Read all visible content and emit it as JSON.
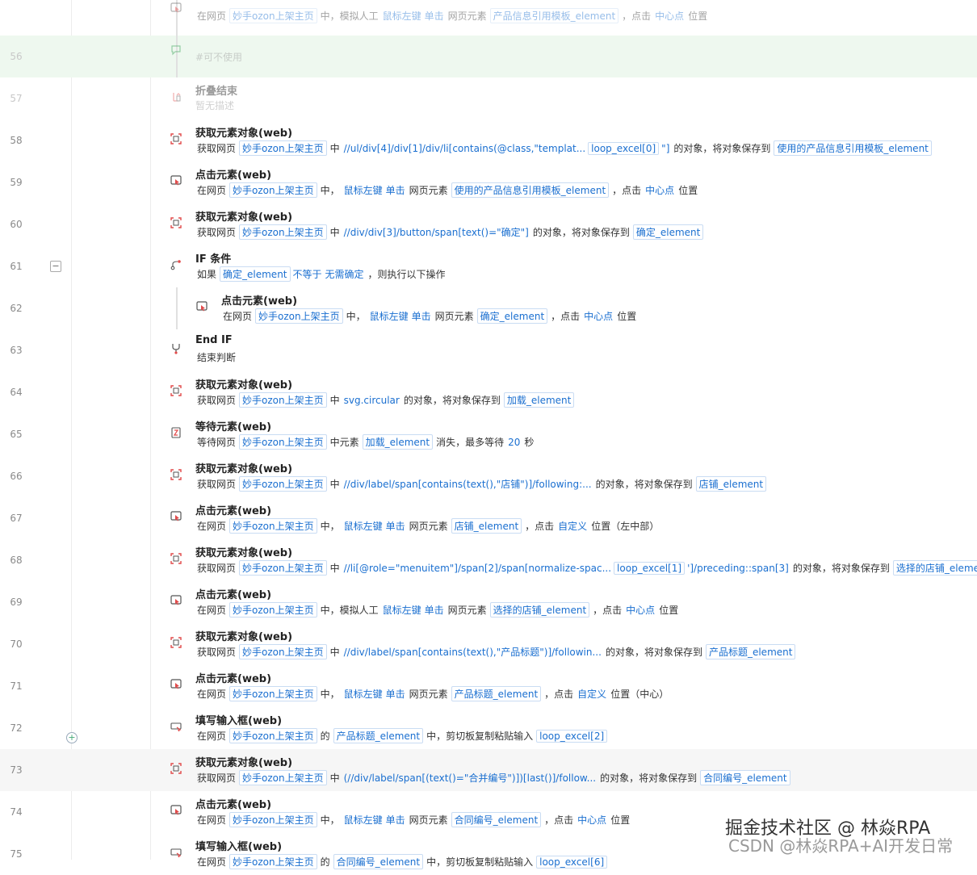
{
  "watermark": {
    "line1": "掘金技术社区 @ 林焱RPA",
    "line2": "CSDN @林焱RPA+AI开发日常",
    "bg": "林焱RPA"
  },
  "rows": [
    {
      "no": "",
      "icon": "click-icon",
      "title": "",
      "faded": true,
      "desc": [
        {
          "t": "tok",
          "v": "在网页"
        },
        {
          "t": "var",
          "v": "妙手ozon上架主页"
        },
        {
          "t": "tok",
          "v": "中，模拟人工"
        },
        {
          "t": "kw",
          "v": "鼠标左键"
        },
        {
          "t": "kw",
          "v": "单击"
        },
        {
          "t": "tok",
          "v": "网页元素"
        },
        {
          "t": "var",
          "v": "产品信息引用模板_element"
        },
        {
          "t": "tok",
          "v": "，点击"
        },
        {
          "t": "kw",
          "v": "中心点"
        },
        {
          "t": "tok",
          "v": "位置"
        }
      ]
    },
    {
      "no": "56",
      "icon": "comment-icon",
      "title": "",
      "faded": true,
      "hl": "green",
      "desc": [
        {
          "t": "sub",
          "v": "#可不使用"
        }
      ]
    },
    {
      "no": "57",
      "icon": "fold-end-icon",
      "title": "折叠结束",
      "faded": true,
      "desc": [
        {
          "t": "sub",
          "v": "暂无描述"
        }
      ]
    },
    {
      "no": "58",
      "icon": "get-element-icon",
      "title": "获取元素对象(web)",
      "desc": [
        {
          "t": "tok",
          "v": "获取网页"
        },
        {
          "t": "var",
          "v": "妙手ozon上架主页"
        },
        {
          "t": "tok",
          "v": "中"
        },
        {
          "t": "kw",
          "v": "//ul/div[4]/div[1]/div/li[contains(@class,\"templat..."
        },
        {
          "t": "var",
          "v": "loop_excel[0]"
        },
        {
          "t": "kw",
          "v": "\"]"
        },
        {
          "t": "tok",
          "v": "的对象，将对象保存到"
        },
        {
          "t": "var",
          "v": "使用的产品信息引用模板_element"
        }
      ]
    },
    {
      "no": "59",
      "icon": "click-icon",
      "title": "点击元素(web)",
      "desc": [
        {
          "t": "tok",
          "v": "在网页"
        },
        {
          "t": "var",
          "v": "妙手ozon上架主页"
        },
        {
          "t": "tok",
          "v": "中，"
        },
        {
          "t": "kw",
          "v": "鼠标左键"
        },
        {
          "t": "kw",
          "v": "单击"
        },
        {
          "t": "tok",
          "v": "网页元素"
        },
        {
          "t": "var",
          "v": "使用的产品信息引用模板_element"
        },
        {
          "t": "tok",
          "v": "，点击"
        },
        {
          "t": "kw",
          "v": "中心点"
        },
        {
          "t": "tok",
          "v": "位置"
        }
      ]
    },
    {
      "no": "60",
      "icon": "get-element-icon",
      "title": "获取元素对象(web)",
      "desc": [
        {
          "t": "tok",
          "v": "获取网页"
        },
        {
          "t": "var",
          "v": "妙手ozon上架主页"
        },
        {
          "t": "tok",
          "v": "中"
        },
        {
          "t": "kw",
          "v": "//div/div[3]/button/span[text()=\"确定\"]"
        },
        {
          "t": "tok",
          "v": "的对象，将对象保存到"
        },
        {
          "t": "var",
          "v": "确定_element"
        }
      ]
    },
    {
      "no": "61",
      "icon": "if-icon",
      "title": "IF 条件",
      "collapse": "−",
      "desc": [
        {
          "t": "tok",
          "v": "如果"
        },
        {
          "t": "var",
          "v": "确定_element"
        },
        {
          "t": "kw",
          "v": "不等于"
        },
        {
          "t": "kw",
          "v": "无需确定"
        },
        {
          "t": "tok",
          "v": "，则执行以下操作"
        }
      ]
    },
    {
      "no": "62",
      "icon": "click-icon",
      "title": "点击元素(web)",
      "nested": true,
      "desc": [
        {
          "t": "tok",
          "v": "在网页"
        },
        {
          "t": "var",
          "v": "妙手ozon上架主页"
        },
        {
          "t": "tok",
          "v": "中，"
        },
        {
          "t": "kw",
          "v": "鼠标左键"
        },
        {
          "t": "kw",
          "v": "单击"
        },
        {
          "t": "tok",
          "v": "网页元素"
        },
        {
          "t": "var",
          "v": "确定_element"
        },
        {
          "t": "tok",
          "v": "，点击"
        },
        {
          "t": "kw",
          "v": "中心点"
        },
        {
          "t": "tok",
          "v": "位置"
        }
      ]
    },
    {
      "no": "63",
      "icon": "end-if-icon",
      "title": "End IF",
      "desc": [
        {
          "t": "tok",
          "v": "结束判断"
        }
      ]
    },
    {
      "no": "64",
      "icon": "get-element-icon",
      "title": "获取元素对象(web)",
      "desc": [
        {
          "t": "tok",
          "v": "获取网页"
        },
        {
          "t": "var",
          "v": "妙手ozon上架主页"
        },
        {
          "t": "tok",
          "v": "中"
        },
        {
          "t": "kw",
          "v": "svg.circular"
        },
        {
          "t": "tok",
          "v": "的对象，将对象保存到"
        },
        {
          "t": "var",
          "v": "加载_element"
        }
      ]
    },
    {
      "no": "65",
      "icon": "wait-icon",
      "title": "等待元素(web)",
      "desc": [
        {
          "t": "tok",
          "v": "等待网页"
        },
        {
          "t": "var",
          "v": "妙手ozon上架主页"
        },
        {
          "t": "tok",
          "v": "中元素"
        },
        {
          "t": "var",
          "v": "加载_element"
        },
        {
          "t": "tok",
          "v": "消失，最多等待"
        },
        {
          "t": "kw",
          "v": "20"
        },
        {
          "t": "tok",
          "v": "秒"
        }
      ]
    },
    {
      "no": "66",
      "icon": "get-element-icon",
      "title": "获取元素对象(web)",
      "desc": [
        {
          "t": "tok",
          "v": "获取网页"
        },
        {
          "t": "var",
          "v": "妙手ozon上架主页"
        },
        {
          "t": "tok",
          "v": "中"
        },
        {
          "t": "kw",
          "v": "//div/label/span[contains(text(),\"店铺\")]/following:..."
        },
        {
          "t": "tok",
          "v": "的对象，将对象保存到"
        },
        {
          "t": "var",
          "v": "店铺_element"
        }
      ]
    },
    {
      "no": "67",
      "icon": "click-icon",
      "title": "点击元素(web)",
      "desc": [
        {
          "t": "tok",
          "v": "在网页"
        },
        {
          "t": "var",
          "v": "妙手ozon上架主页"
        },
        {
          "t": "tok",
          "v": "中，"
        },
        {
          "t": "kw",
          "v": "鼠标左键"
        },
        {
          "t": "kw",
          "v": "单击"
        },
        {
          "t": "tok",
          "v": "网页元素"
        },
        {
          "t": "var",
          "v": "店铺_element"
        },
        {
          "t": "tok",
          "v": "，点击"
        },
        {
          "t": "kw",
          "v": "自定义"
        },
        {
          "t": "tok",
          "v": "位置（左中部）"
        }
      ]
    },
    {
      "no": "68",
      "icon": "get-element-icon",
      "title": "获取元素对象(web)",
      "desc": [
        {
          "t": "tok",
          "v": "获取网页"
        },
        {
          "t": "var",
          "v": "妙手ozon上架主页"
        },
        {
          "t": "tok",
          "v": "中"
        },
        {
          "t": "kw",
          "v": "//li[@role=\"menuitem\"]/span[2]/span[normalize-spac..."
        },
        {
          "t": "var",
          "v": "loop_excel[1]"
        },
        {
          "t": "kw",
          "v": "']/preceding::span[3]"
        },
        {
          "t": "tok",
          "v": "的对象，将对象保存到"
        },
        {
          "t": "var",
          "v": "选择的店铺_element"
        }
      ]
    },
    {
      "no": "69",
      "icon": "click-icon",
      "title": "点击元素(web)",
      "desc": [
        {
          "t": "tok",
          "v": "在网页"
        },
        {
          "t": "var",
          "v": "妙手ozon上架主页"
        },
        {
          "t": "tok",
          "v": "中，模拟人工"
        },
        {
          "t": "kw",
          "v": "鼠标左键"
        },
        {
          "t": "kw",
          "v": "单击"
        },
        {
          "t": "tok",
          "v": "网页元素"
        },
        {
          "t": "var",
          "v": "选择的店铺_element"
        },
        {
          "t": "tok",
          "v": "，点击"
        },
        {
          "t": "kw",
          "v": "中心点"
        },
        {
          "t": "tok",
          "v": "位置"
        }
      ]
    },
    {
      "no": "70",
      "icon": "get-element-icon",
      "title": "获取元素对象(web)",
      "desc": [
        {
          "t": "tok",
          "v": "获取网页"
        },
        {
          "t": "var",
          "v": "妙手ozon上架主页"
        },
        {
          "t": "tok",
          "v": "中"
        },
        {
          "t": "kw",
          "v": "//div/label/span[contains(text(),\"产品标题\")]/followin..."
        },
        {
          "t": "tok",
          "v": "的对象，将对象保存到"
        },
        {
          "t": "var",
          "v": "产品标题_element"
        }
      ]
    },
    {
      "no": "71",
      "icon": "click-icon",
      "title": "点击元素(web)",
      "desc": [
        {
          "t": "tok",
          "v": "在网页"
        },
        {
          "t": "var",
          "v": "妙手ozon上架主页"
        },
        {
          "t": "tok",
          "v": "中，"
        },
        {
          "t": "kw",
          "v": "鼠标左键"
        },
        {
          "t": "kw",
          "v": "单击"
        },
        {
          "t": "tok",
          "v": "网页元素"
        },
        {
          "t": "var",
          "v": "产品标题_element"
        },
        {
          "t": "tok",
          "v": "，点击"
        },
        {
          "t": "kw",
          "v": "自定义"
        },
        {
          "t": "tok",
          "v": "位置（中心）"
        }
      ]
    },
    {
      "no": "72",
      "icon": "input-icon",
      "title": "填写输入框(web)",
      "desc": [
        {
          "t": "tok",
          "v": "在网页"
        },
        {
          "t": "var",
          "v": "妙手ozon上架主页"
        },
        {
          "t": "tok",
          "v": "的"
        },
        {
          "t": "var",
          "v": "产品标题_element"
        },
        {
          "t": "tok",
          "v": "中，剪切板复制粘贴输入"
        },
        {
          "t": "var",
          "v": "loop_excel[2]"
        }
      ]
    },
    {
      "no": "73",
      "icon": "get-element-icon",
      "title": "获取元素对象(web)",
      "hl": "gray",
      "desc": [
        {
          "t": "tok",
          "v": "获取网页"
        },
        {
          "t": "var",
          "v": "妙手ozon上架主页"
        },
        {
          "t": "tok",
          "v": "中"
        },
        {
          "t": "kw",
          "v": "(//div/label/span[(text()=\"合并编号\")])[last()]/follow..."
        },
        {
          "t": "tok",
          "v": "的对象，将对象保存到"
        },
        {
          "t": "var",
          "v": "合同编号_element"
        }
      ]
    },
    {
      "no": "74",
      "icon": "click-icon",
      "title": "点击元素(web)",
      "desc": [
        {
          "t": "tok",
          "v": "在网页"
        },
        {
          "t": "var",
          "v": "妙手ozon上架主页"
        },
        {
          "t": "tok",
          "v": "中，"
        },
        {
          "t": "kw",
          "v": "鼠标左键"
        },
        {
          "t": "kw",
          "v": "单击"
        },
        {
          "t": "tok",
          "v": "网页元素"
        },
        {
          "t": "var",
          "v": "合同编号_element"
        },
        {
          "t": "tok",
          "v": "，点击"
        },
        {
          "t": "kw",
          "v": "中心点"
        },
        {
          "t": "tok",
          "v": "位置"
        }
      ]
    },
    {
      "no": "75",
      "icon": "input-icon",
      "title": "填写输入框(web)",
      "desc": [
        {
          "t": "tok",
          "v": "在网页"
        },
        {
          "t": "var",
          "v": "妙手ozon上架主页"
        },
        {
          "t": "tok",
          "v": "的"
        },
        {
          "t": "var",
          "v": "合同编号_element"
        },
        {
          "t": "tok",
          "v": "中，剪切板复制粘贴输入"
        },
        {
          "t": "var",
          "v": "loop_excel[6]"
        }
      ]
    }
  ]
}
